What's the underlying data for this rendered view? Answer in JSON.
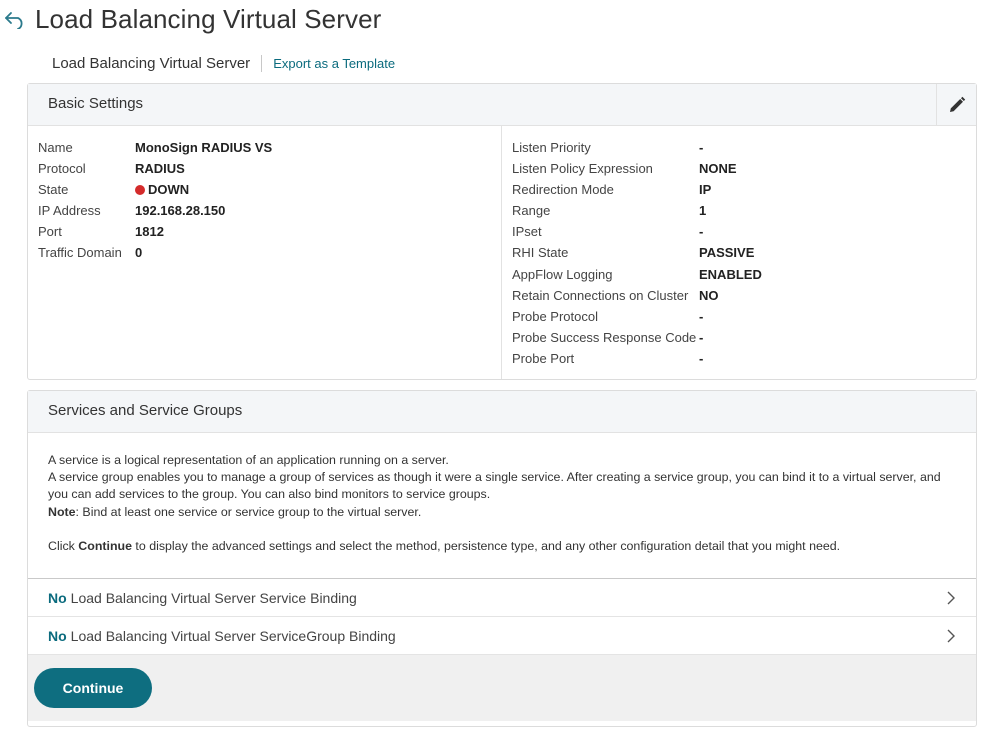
{
  "header": {
    "title": "Load Balancing Virtual Server",
    "back_icon": "back-arrow-icon"
  },
  "breadcrumb": {
    "current": "Load Balancing Virtual Server",
    "export_link": "Export as a Template"
  },
  "basic_settings": {
    "title": "Basic Settings",
    "edit_icon": "pencil-icon",
    "left": [
      {
        "label": "Name",
        "value": "MonoSign RADIUS VS"
      },
      {
        "label": "Protocol",
        "value": "RADIUS"
      },
      {
        "label": "State",
        "value": "DOWN"
      },
      {
        "label": "IP Address",
        "value": "192.168.28.150"
      },
      {
        "label": "Port",
        "value": "1812"
      },
      {
        "label": "Traffic Domain",
        "value": "0"
      }
    ],
    "right": [
      {
        "label": "Listen Priority",
        "value": "-"
      },
      {
        "label": "Listen Policy Expression",
        "value": "NONE"
      },
      {
        "label": "Redirection Mode",
        "value": "IP"
      },
      {
        "label": "Range",
        "value": "1"
      },
      {
        "label": "IPset",
        "value": "-"
      },
      {
        "label": "RHI State",
        "value": "PASSIVE"
      },
      {
        "label": "AppFlow Logging",
        "value": "ENABLED"
      },
      {
        "label": "Retain Connections on Cluster",
        "value": "NO"
      },
      {
        "label": "Probe Protocol",
        "value": "-"
      },
      {
        "label": "Probe Success Response Code",
        "value": "-"
      },
      {
        "label": "Probe Port",
        "value": "-"
      }
    ],
    "state_color": "#d42b2b"
  },
  "services": {
    "title": "Services and Service Groups",
    "desc_line1": "A service is a logical representation of an application running on a server.",
    "desc_line2": "A service group enables you to manage a group of services as though it were a single service. After creating a service group, you can bind it to a virtual server, and you can add services to the group. You can also bind monitors to service groups.",
    "note_label": "Note",
    "note_text": ": Bind at least one service or service group to the virtual server.",
    "click_prefix": "Click ",
    "click_bold": "Continue",
    "click_suffix": " to display the advanced settings and select the method, persistence type, and any other configuration detail that you might need.",
    "bindings": [
      {
        "no": "No",
        "label": "Load Balancing Virtual Server Service Binding"
      },
      {
        "no": "No",
        "label": "Load Balancing Virtual Server ServiceGroup Binding"
      }
    ],
    "chevron_icon": "chevron-right-icon"
  },
  "footer": {
    "continue_label": "Continue"
  },
  "colors": {
    "accent": "#0e6e80",
    "link": "#0b6b7e"
  }
}
